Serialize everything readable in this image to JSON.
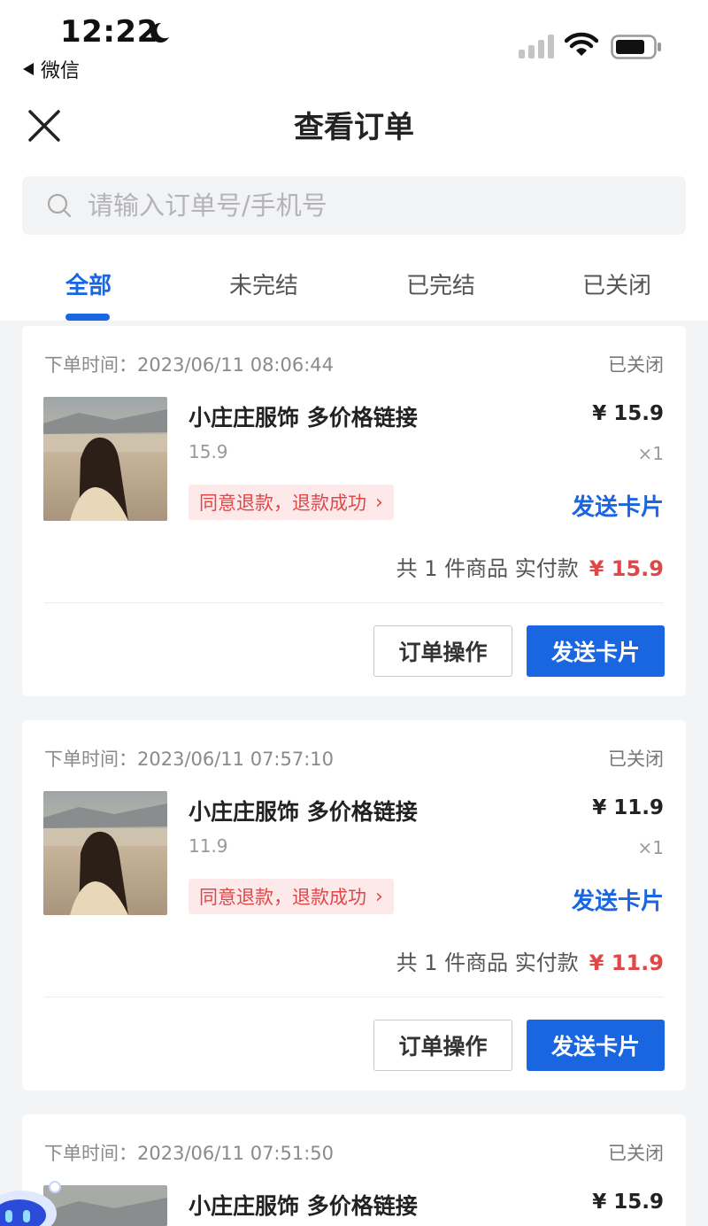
{
  "status_bar": {
    "time": "12:22",
    "back_app": "微信"
  },
  "header": {
    "title": "查看订单"
  },
  "search": {
    "placeholder": "请输入订单号/手机号"
  },
  "tabs": [
    {
      "label": "全部",
      "active": true
    },
    {
      "label": "未完结",
      "active": false
    },
    {
      "label": "已完结",
      "active": false
    },
    {
      "label": "已关闭",
      "active": false
    }
  ],
  "orders": [
    {
      "time_label": "下单时间：",
      "time": "2023/06/11 08:06:44",
      "status": "已关闭",
      "product_name": "小庄庄服饰 多价格链接",
      "price": "¥ 15.9",
      "spec": "15.9",
      "qty": "×1",
      "refund_tag": "同意退款，退款成功",
      "send_link": "发送卡片",
      "summary_text": "共 1 件商品 实付款",
      "summary_amount": "¥ 15.9",
      "btn_op": "订单操作",
      "btn_send": "发送卡片"
    },
    {
      "time_label": "下单时间：",
      "time": "2023/06/11 07:57:10",
      "status": "已关闭",
      "product_name": "小庄庄服饰 多价格链接",
      "price": "¥ 11.9",
      "spec": "11.9",
      "qty": "×1",
      "refund_tag": "同意退款，退款成功",
      "send_link": "发送卡片",
      "summary_text": "共 1 件商品 实付款",
      "summary_amount": "¥ 11.9",
      "btn_op": "订单操作",
      "btn_send": "发送卡片"
    },
    {
      "time_label": "下单时间：",
      "time": "2023/06/11 07:51:50",
      "status": "已关闭",
      "product_name": "小庄庄服饰 多价格链接",
      "price": "¥ 15.9"
    }
  ],
  "colors": {
    "accent": "#1a66e0",
    "refund_text": "#e04848",
    "refund_bg": "#fde8ea",
    "page_bg": "#f3f4f6"
  },
  "icons": {
    "moon": "moon-icon",
    "signal": "cellular-signal-icon",
    "wifi": "wifi-icon",
    "battery": "battery-icon",
    "close": "close-icon",
    "search": "search-icon",
    "chevron": "chevron-right-icon"
  }
}
